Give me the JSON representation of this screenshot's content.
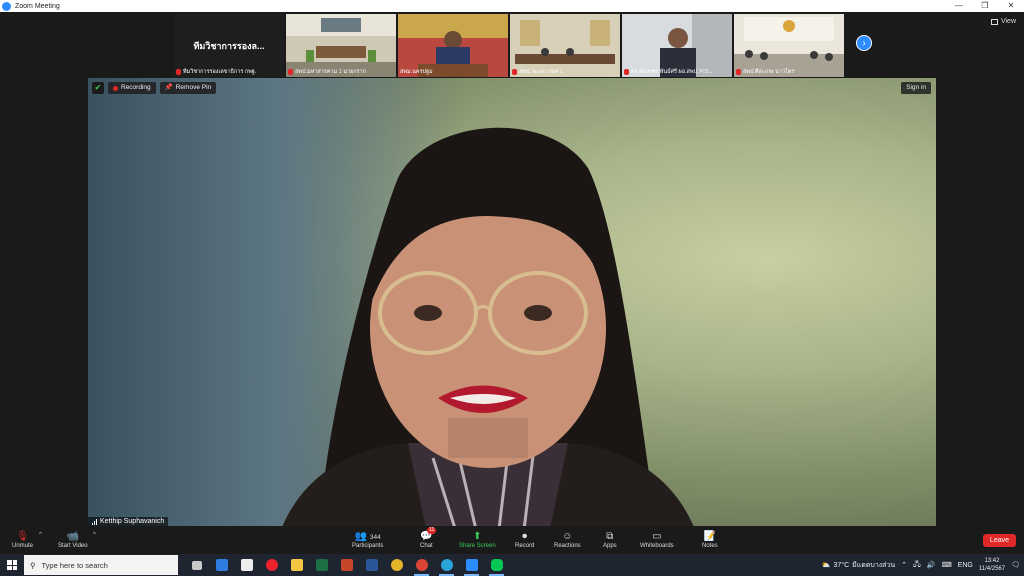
{
  "window": {
    "title": "Zoom Meeting"
  },
  "gallery": {
    "tiles": [
      {
        "name": "ทีมวิชาการรองเลขาธิการ กพฐ.",
        "display": "ทีมวิชาการรองล..."
      },
      {
        "name": "สพป.มหาสารคาม 1 นายกราก"
      },
      {
        "name": "สพม.นครปฐม"
      },
      {
        "name": "สพป. พะเยา เขต 1"
      },
      {
        "name": "ดร.สมเพชร พันธ์ศรี ผอ.สพป. P.S..."
      },
      {
        "name": "สพป.ศีสะเกษ นาวไตร"
      }
    ],
    "view_label": "View"
  },
  "main_video": {
    "recording_label": "Recording",
    "remove_pin_label": "Remove Pin",
    "sign_in_label": "Sign in",
    "speaker_name": "Ketthip Suphavanich"
  },
  "toolbar": {
    "unmute": "Unmute",
    "start_video": "Start Video",
    "participants": "Participants",
    "participants_count": "344",
    "chat": "Chat",
    "chat_badge": "11",
    "share_screen": "Share Screen",
    "record": "Record",
    "reactions": "Reactions",
    "apps": "Apps",
    "whiteboards": "Whiteboards",
    "notes": "Notes",
    "leave": "Leave"
  },
  "taskbar": {
    "search_placeholder": "Type here to search",
    "weather_temp": "37°C",
    "weather_desc": "มีแดดบางส่วน",
    "lang": "ENG",
    "time": "13:42",
    "date": "11/4/2567"
  }
}
